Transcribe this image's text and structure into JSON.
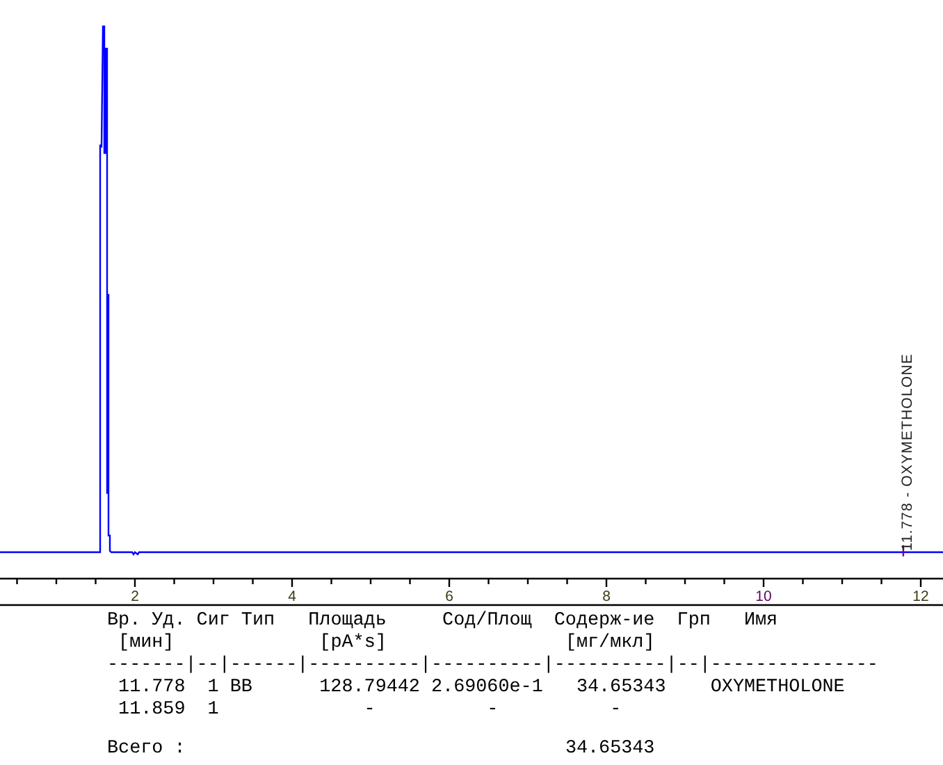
{
  "plot": {
    "peak_label": "11.778 - OXYMETHOLONE",
    "x_ticks": [
      "2",
      "4",
      "6",
      "8",
      "10",
      "12"
    ]
  },
  "table": {
    "header": [
      "Вр. Уд.",
      "Сиг",
      "Тип",
      "Площадь",
      "Сод/Площ",
      "Содерж-ие",
      "Грп",
      "Имя"
    ],
    "units": [
      "[мин]",
      "[pA*s]",
      "[мг/мкл]"
    ],
    "separator": "-------|--|------|----------|----------|----------|--|---------------",
    "rows": [
      {
        "cells": [
          {
            "text": "11.778",
            "kind": "value"
          },
          {
            "text": "1",
            "kind": "value"
          },
          {
            "text": "BB",
            "kind": "value"
          },
          {
            "text": "128.79442",
            "kind": "value"
          },
          {
            "text": "2.69060e-1",
            "kind": "value"
          },
          {
            "text": "34.65343",
            "kind": "value"
          },
          {
            "text": "",
            "kind": "none"
          },
          {
            "text": "OXYMETHOLONE",
            "kind": "value"
          }
        ]
      },
      {
        "cells": [
          {
            "text": "11.859",
            "kind": "value"
          },
          {
            "text": "1",
            "kind": "value"
          },
          {
            "text": "",
            "kind": "none"
          },
          {
            "text": "-",
            "kind": "dash"
          },
          {
            "text": "-",
            "kind": "dash"
          },
          {
            "text": "-",
            "kind": "dash"
          }
        ]
      }
    ],
    "total": {
      "label": "Всего :",
      "value": "34.65343"
    }
  }
}
